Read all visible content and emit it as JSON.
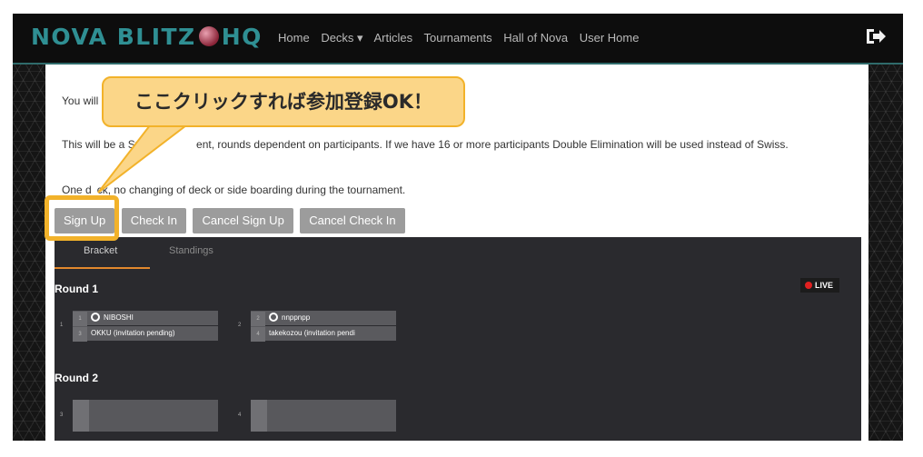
{
  "navbar": {
    "logo_left": "NOVA BLITZ",
    "logo_right": "HQ",
    "links": [
      "Home",
      "Decks ▾",
      "Articles",
      "Tournaments",
      "Hall of Nova",
      "User Home"
    ],
    "logout_icon": "sign-out-icon"
  },
  "content": {
    "line1": "You will",
    "line2a": "This will be a Swi",
    "line2b": "ent, rounds dependent on participants.  If we have 16 or more participants Double Elimination will be used instead of Swiss.",
    "line3a": "One d",
    "line3b": "ck, no changing of deck or side boarding during the tournament."
  },
  "buttons": {
    "sign_up": "Sign Up",
    "check_in": "Check In",
    "cancel_sign_up": "Cancel Sign Up",
    "cancel_check_in": "Cancel Check In"
  },
  "bracket": {
    "tab_bracket": "Bracket",
    "tab_standings": "Standings",
    "live": "LIVE",
    "round1_label": "Round 1",
    "round2_label": "Round 2",
    "round1_matches": [
      {
        "num": "1",
        "p1_seed": "1",
        "p1": "NIBOSHI",
        "p2_seed": "3",
        "p2": "OKKU (invitation pending)"
      },
      {
        "num": "2",
        "p1_seed": "2",
        "p1": "nnppnpp",
        "p2_seed": "4",
        "p2": "takekozou (invitation pendi"
      }
    ],
    "round2_matches": [
      {
        "num": "3"
      },
      {
        "num": "4"
      }
    ]
  },
  "callout": {
    "text": "ここクリックすれば参加登録OK！"
  },
  "colors": {
    "accent": "#2f8f93",
    "tab_underline": "#e2882d",
    "callout_border": "#f2b22a",
    "callout_fill": "#fbd688",
    "live_dot": "#e02020"
  }
}
